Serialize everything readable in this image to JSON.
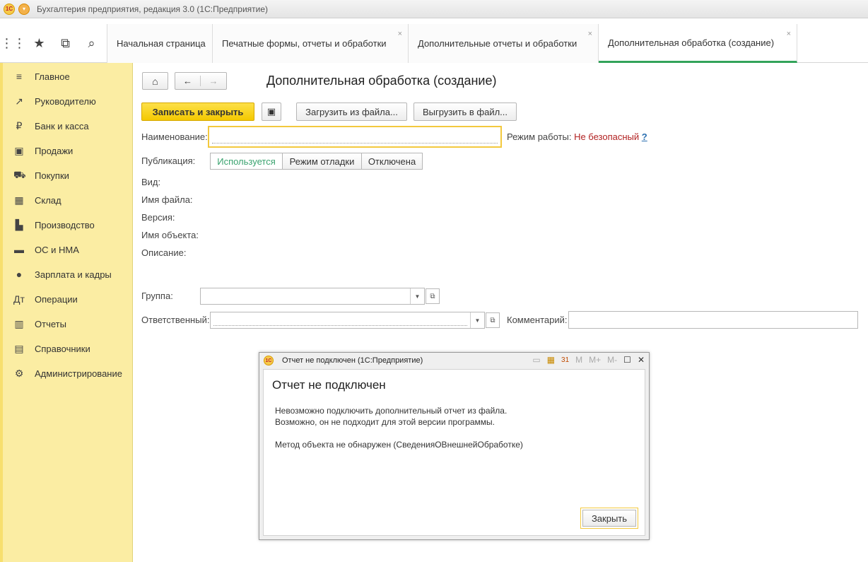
{
  "window": {
    "title": "Бухгалтерия предприятия, редакция 3.0  (1С:Предприятие)"
  },
  "toolbar": {
    "icons": [
      "apps-grid-icon",
      "star-icon",
      "history-icon",
      "search-icon"
    ]
  },
  "tabs": [
    {
      "label": "Начальная страница",
      "closable": false
    },
    {
      "label": "Печатные формы, отчеты и обработки",
      "closable": true
    },
    {
      "label": "Дополнительные отчеты и обработки",
      "closable": true
    },
    {
      "label": "Дополнительная обработка (создание)",
      "closable": true,
      "active": true
    }
  ],
  "tab_close_glyph": "×",
  "sidebar": {
    "items": [
      {
        "label": "Главное",
        "icon": "menu-lines-icon"
      },
      {
        "label": "Руководителю",
        "icon": "trend-icon"
      },
      {
        "label": "Банк и касса",
        "icon": "ruble-icon"
      },
      {
        "label": "Продажи",
        "icon": "bag-icon"
      },
      {
        "label": "Покупки",
        "icon": "cart-icon"
      },
      {
        "label": "Склад",
        "icon": "warehouse-icon"
      },
      {
        "label": "Производство",
        "icon": "factory-icon"
      },
      {
        "label": "ОС и НМА",
        "icon": "truck-icon"
      },
      {
        "label": "Зарплата и кадры",
        "icon": "person-icon"
      },
      {
        "label": "Операции",
        "icon": "operations-icon"
      },
      {
        "label": "Отчеты",
        "icon": "bar-chart-icon"
      },
      {
        "label": "Справочники",
        "icon": "books-icon"
      },
      {
        "label": "Администрирование",
        "icon": "gear-icon"
      }
    ]
  },
  "form": {
    "title": "Дополнительная обработка (создание)",
    "buttons": {
      "save_close": "Записать и закрыть",
      "load_from_file": "Загрузить из файла...",
      "unload_to_file": "Выгрузить в файл..."
    },
    "fields": {
      "name_label": "Наименование:",
      "name_value": "",
      "mode_label": "Режим работы:",
      "mode_value": "Не безопасный",
      "help": "?",
      "publication_label": "Публикация:",
      "publication_options": [
        "Используется",
        "Режим отладки",
        "Отключена"
      ],
      "publication_selected": "Используется",
      "kind_label": "Вид:",
      "file_label": "Имя файла:",
      "version_label": "Версия:",
      "object_label": "Имя объекта:",
      "description_label": "Описание:",
      "group_label": "Группа:",
      "group_value": "",
      "responsible_label": "Ответственный:",
      "responsible_value": "",
      "comment_label": "Комментарий:",
      "comment_value": ""
    }
  },
  "dialog": {
    "window_title": "Отчет не подключен  (1С:Предприятие)",
    "heading": "Отчет не подключен",
    "line1": "Невозможно подключить дополнительный отчет из файла.",
    "line2": "Возможно, он не подходит для этой версии программы.",
    "line3": "Метод объекта не обнаружен (СведенияОВнешнейОбработке)",
    "close_button": "Закрыть",
    "tools": [
      "M",
      "M+",
      "M-"
    ]
  }
}
